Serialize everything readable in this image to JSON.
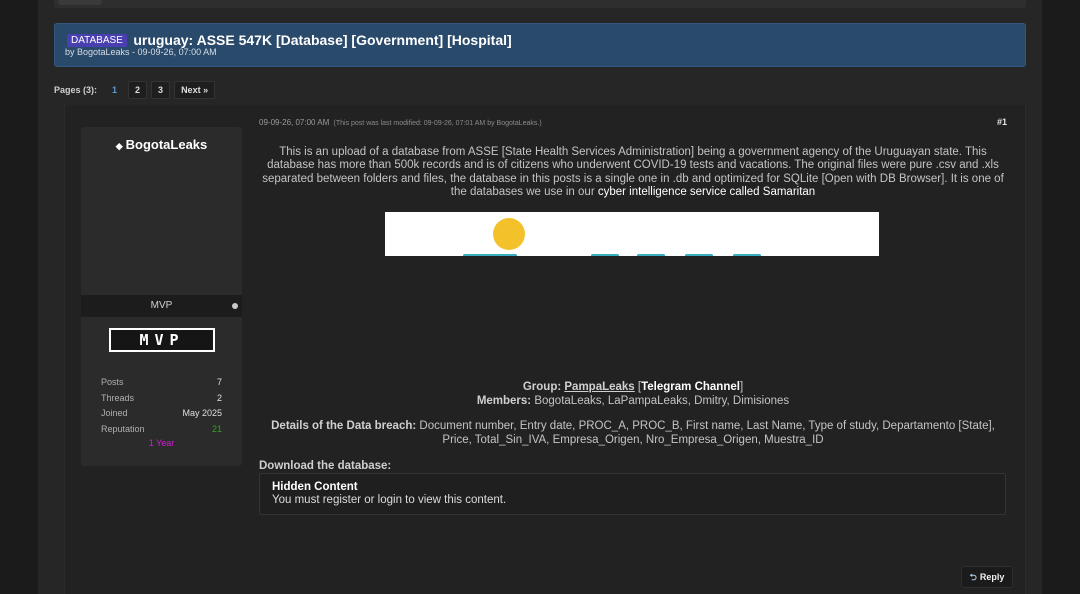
{
  "thread": {
    "prefix": "DATABASE",
    "title": "uruguay: ASSE 547K [Database] [Government] [Hospital]",
    "meta": "by BogotaLeaks - 09-09-26, 07:00 AM"
  },
  "pagination": {
    "label": "Pages (3):",
    "pages": [
      "1",
      "2",
      "3"
    ],
    "next": "Next »"
  },
  "post": {
    "date": "09-09-26, 07:00 AM",
    "modified": "(This post was last modified: 09-09-26, 07:01 AM by BogotaLeaks.)",
    "number": "#1",
    "body_text": "This is an upload of a database from ASSE [State Health Services Administration] being a government agency of the Uruguayan state. This database has more than 500k records and is of citizens who underwent COVID-19 tests and vacations. The original files were pure .csv and .xls separated between folders and files, the database in this posts is a single one in .db and optimized for SQLite [Open with DB Browser]. It is one of the databases we use in our",
    "body_link": "cyber intelligence service called Samaritan",
    "group_label": "Group:",
    "group_name": "PampaLeaks",
    "group_open": "[",
    "telegram": "Telegram Channel",
    "group_close": "]",
    "members_label": "Members:",
    "members": "BogotaLeaks, LaPampaLeaks, Dmitry, Dimisiones",
    "details_label": "Details of the Data breach:",
    "details": "Document number, Entry date, PROC_A, PROC_B, First name, Last Name, Type of study, Departamento [State], Price, Total_Sin_IVA, Empresa_Origen, Nro_Empresa_Origen, Muestra_ID",
    "download_label": "Download the database:",
    "hidden_title": "Hidden Content",
    "hidden_message": "You must register or login to view this content.",
    "reply_label": "Reply"
  },
  "author": {
    "name": "BogotaLeaks",
    "rank": "MVP",
    "badge": "MVP",
    "stats": [
      {
        "label": "Posts",
        "value": "7"
      },
      {
        "label": "Threads",
        "value": "2"
      },
      {
        "label": "Joined",
        "value": "May 2025"
      },
      {
        "label": "Reputation",
        "value": "21"
      }
    ],
    "tenure": "1 Year"
  },
  "colors": {
    "header_bg": "#2a4a6b",
    "prefix_bg": "#4a3fb0",
    "reputation": "#2fa31f",
    "tenure": "#d01fd0",
    "current_page": "#5b9bd5"
  },
  "icons": {
    "author": "diamond-icon",
    "reply": "reply-arrow-icon",
    "online": "online-status-dot"
  }
}
